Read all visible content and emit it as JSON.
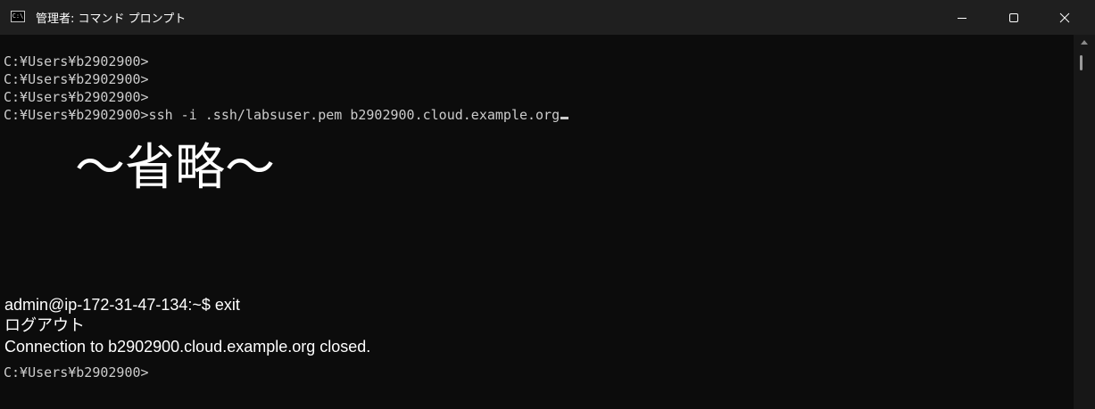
{
  "window": {
    "title": "管理者: コマンド プロンプト",
    "app_icon_text": "C:\\",
    "controls": {
      "minimize": "minimize-icon",
      "maximize": "maximize-icon",
      "close": "close-icon"
    }
  },
  "console": {
    "lines": [
      "C:¥Users¥b2902900>",
      "C:¥Users¥b2902900>",
      "C:¥Users¥b2902900>",
      "C:¥Users¥b2902900>ssh -i .ssh/labsuser.pem b2902900.cloud.example.org"
    ],
    "omitted_label": "〜省略〜",
    "session_lines": [
      "admin@ip-172-31-47-134:~$ exit",
      "ログアウト",
      "Connection to b2902900.cloud.example.org closed."
    ],
    "final_prompt": "C:¥Users¥b2902900>"
  },
  "colors": {
    "background": "#0c0c0c",
    "titlebar": "#1f1f1f",
    "text": "#cccccc"
  }
}
